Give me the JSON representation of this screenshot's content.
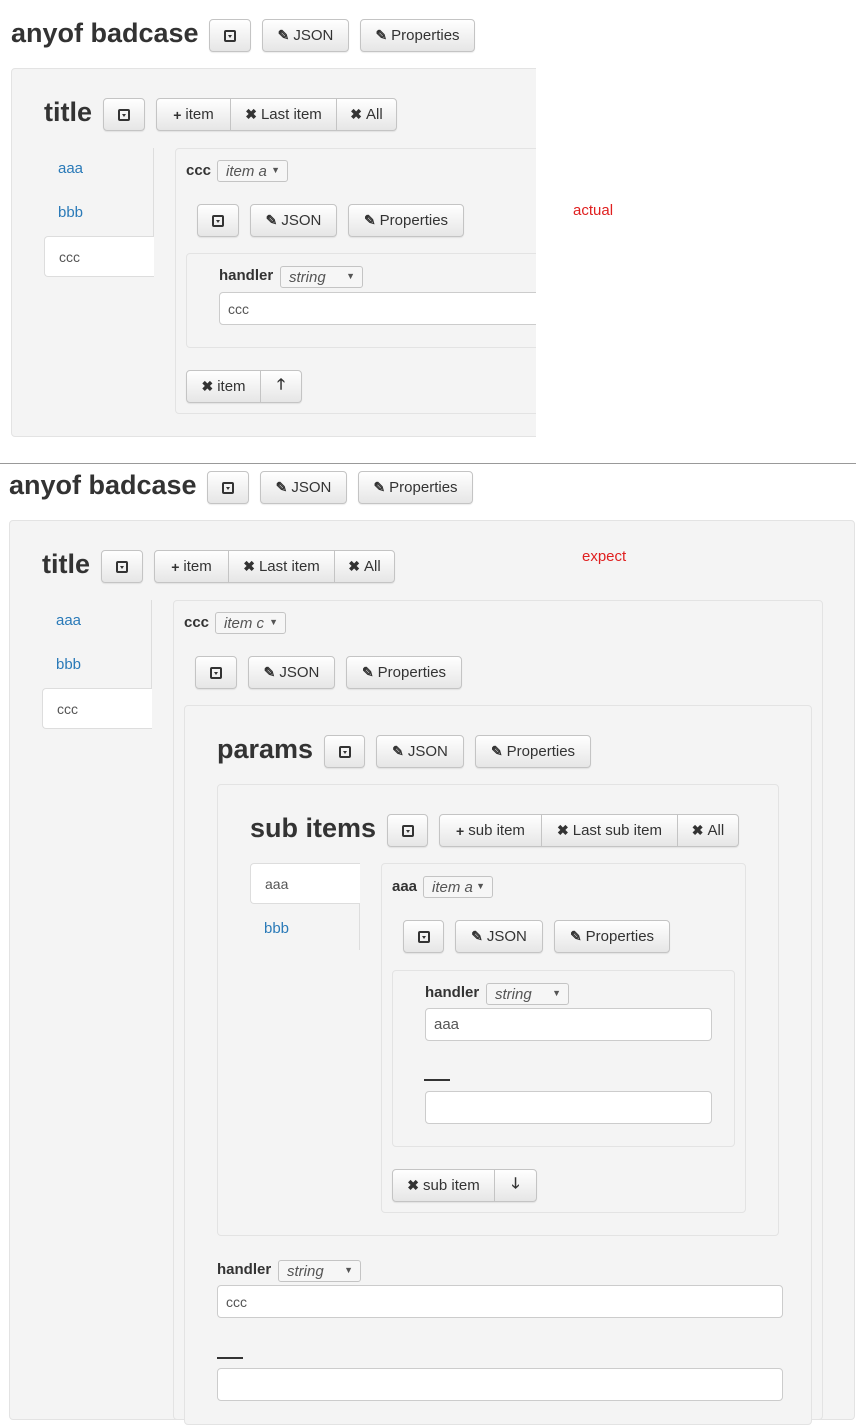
{
  "panels": {
    "actual": {
      "note": "actual",
      "header": {
        "title": "anyof badcase",
        "json_label": "JSON",
        "properties_label": "Properties"
      },
      "array": {
        "title": "title",
        "add_label": "item",
        "remove_last_label": "Last item",
        "remove_all_label": "All",
        "tabs": [
          {
            "label": "aaa"
          },
          {
            "label": "bbb"
          },
          {
            "label": "ccc",
            "active": true
          }
        ],
        "item": {
          "label": "ccc",
          "type_select": "item a",
          "json_label": "JSON",
          "properties_label": "Properties",
          "handler": {
            "label": "handler",
            "type_select": "string",
            "value": "ccc"
          },
          "delete_label": "item",
          "move_icon": "arrow-up-icon"
        }
      }
    },
    "expect": {
      "note": "expect",
      "header": {
        "title": "anyof badcase",
        "json_label": "JSON",
        "properties_label": "Properties"
      },
      "array": {
        "title": "title",
        "add_label": "item",
        "remove_last_label": "Last item",
        "remove_all_label": "All",
        "tabs": [
          {
            "label": "aaa"
          },
          {
            "label": "bbb"
          },
          {
            "label": "ccc",
            "active": true
          }
        ],
        "item": {
          "label": "ccc",
          "type_select": "item c",
          "json_label": "JSON",
          "properties_label": "Properties",
          "params": {
            "title": "params",
            "json_label": "JSON",
            "properties_label": "Properties",
            "sub_items": {
              "title": "sub items",
              "add_label": "sub item",
              "remove_last_label": "Last sub item",
              "remove_all_label": "All",
              "tabs": [
                {
                  "label": "aaa",
                  "active": true
                },
                {
                  "label": "bbb"
                }
              ],
              "item": {
                "label": "aaa",
                "type_select": "item a",
                "json_label": "JSON",
                "properties_label": "Properties",
                "handler": {
                  "label": "handler",
                  "type_select": "string",
                  "value": "aaa"
                },
                "blank_label": "___",
                "blank_value": "",
                "delete_label": "sub item",
                "move_icon": "arrow-down-icon"
              }
            }
          },
          "handler": {
            "label": "handler",
            "type_select": "string",
            "value": "ccc"
          },
          "blank_label": "___",
          "blank_value": ""
        }
      }
    }
  }
}
